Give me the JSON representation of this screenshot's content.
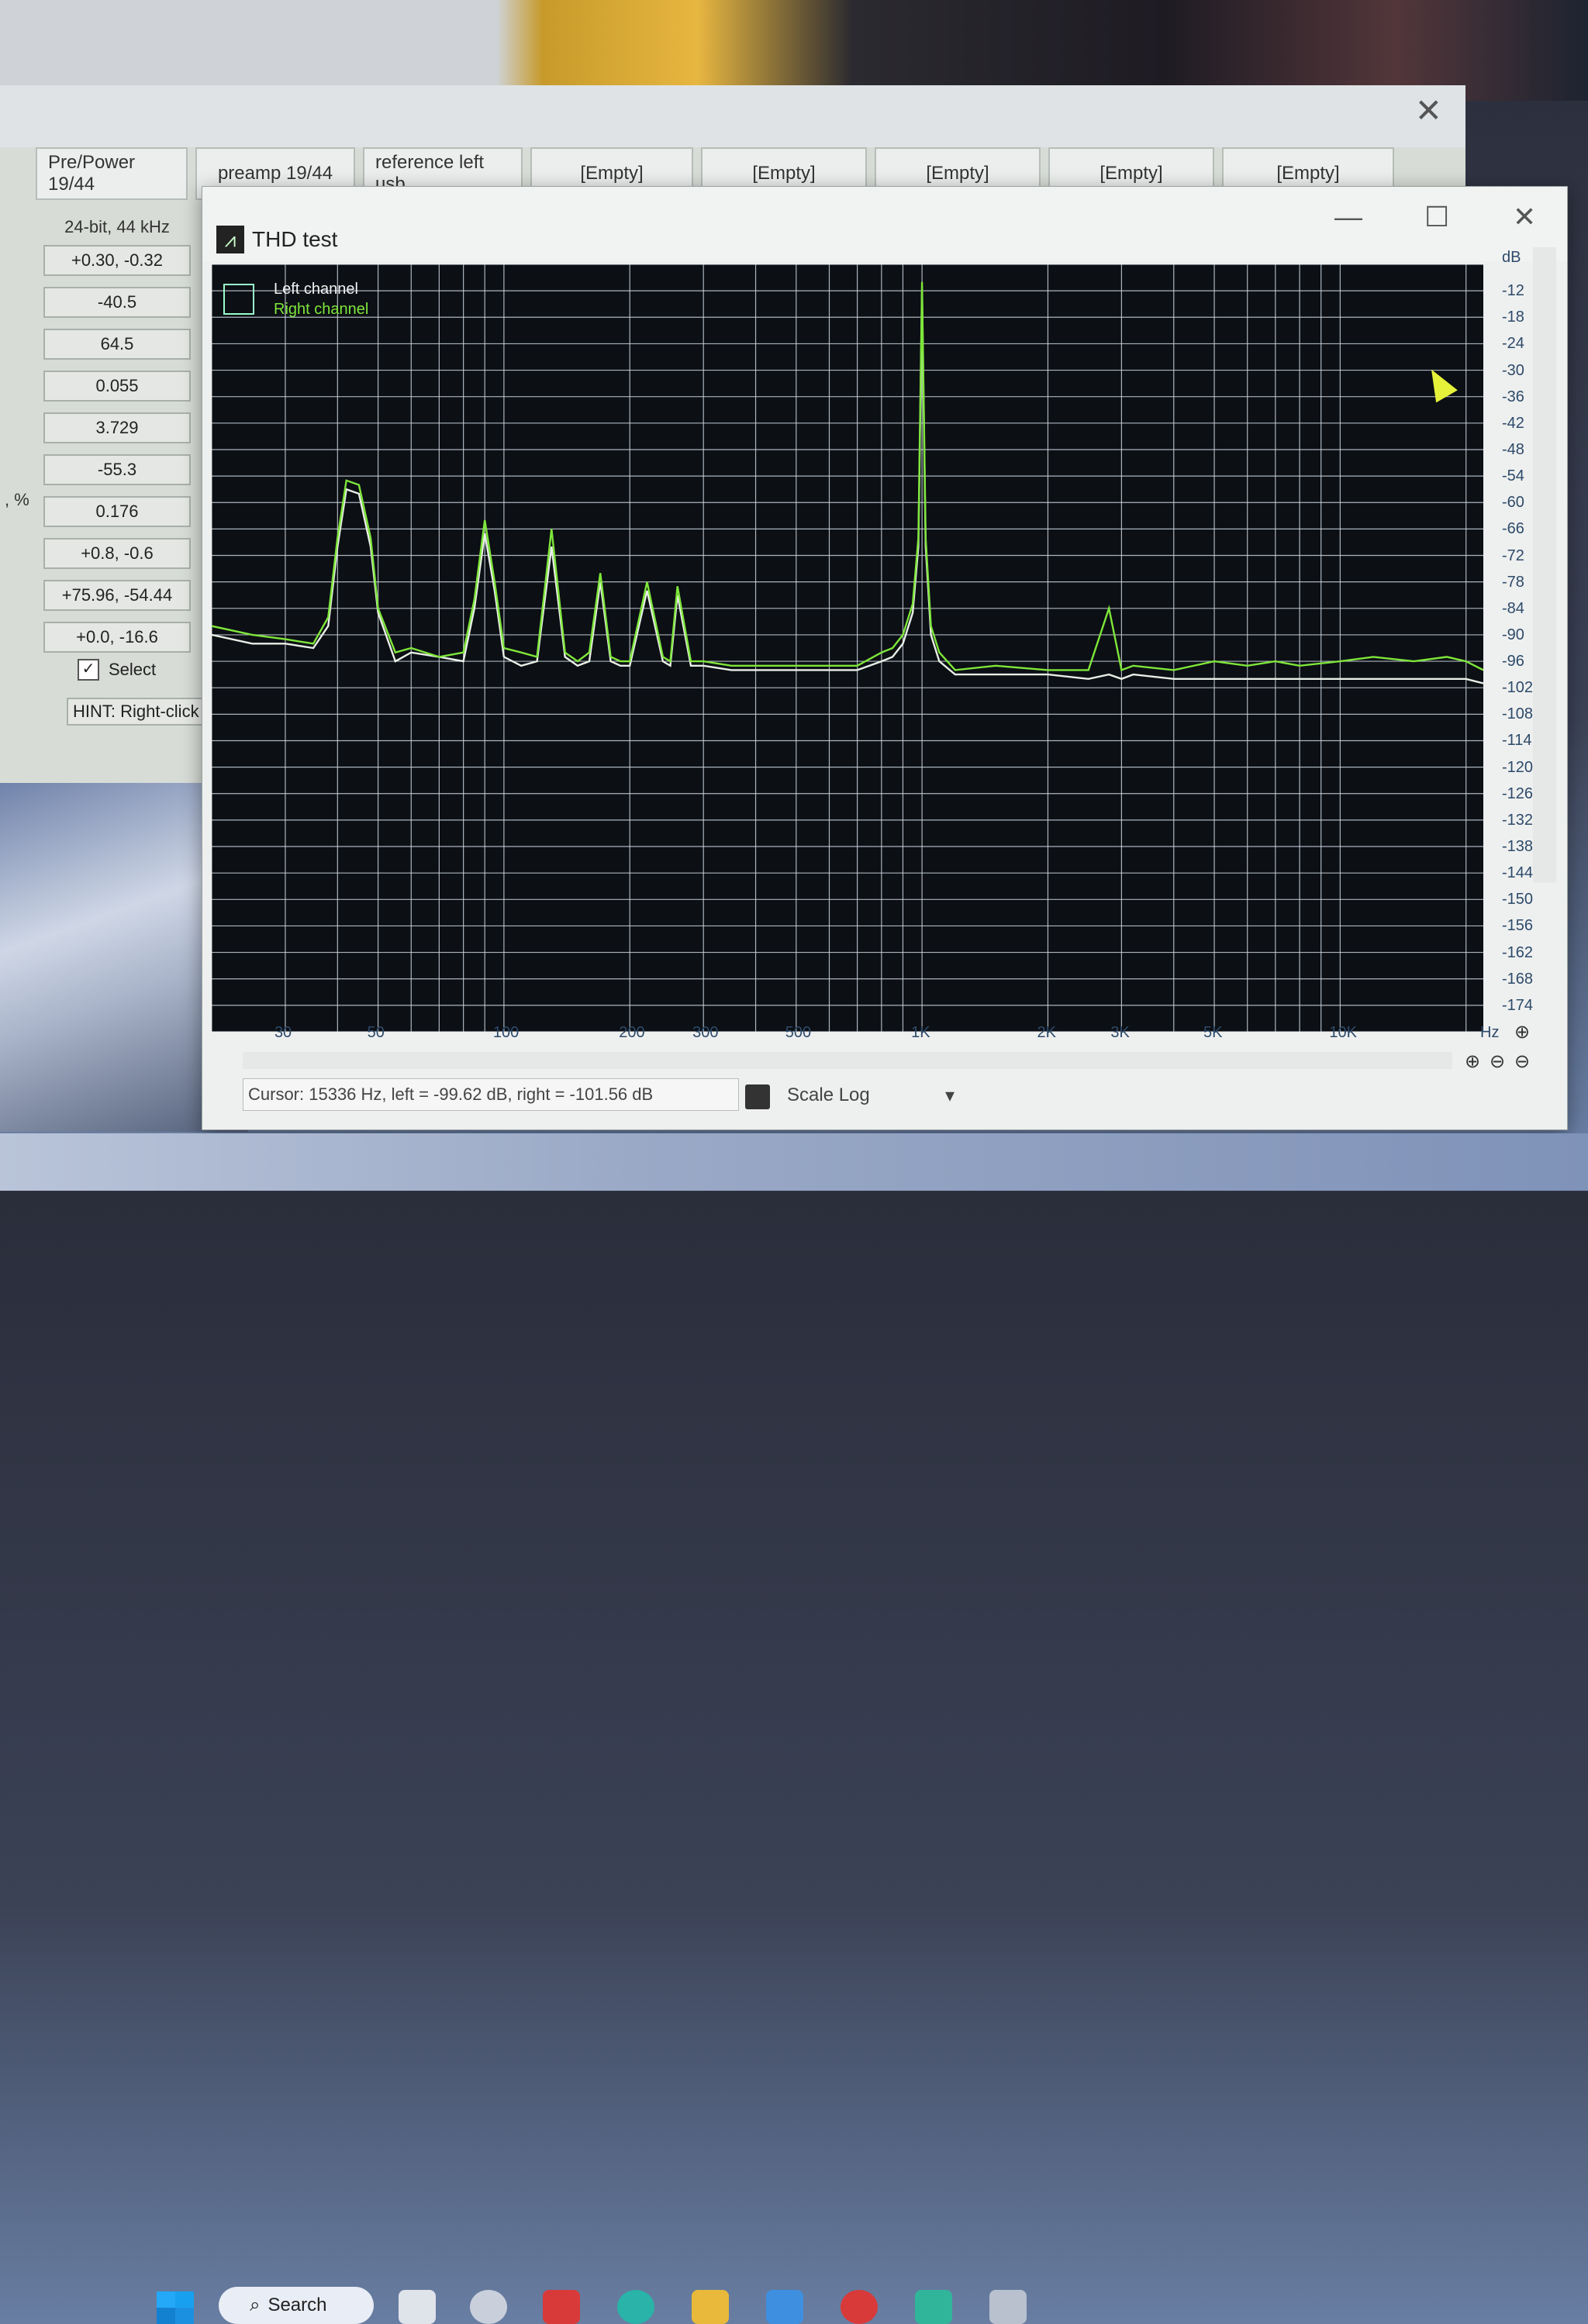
{
  "main_window": {
    "close_glyph": "✕",
    "tabs": [
      "Pre/Power 19/44",
      "preamp 19/44",
      "reference left usb",
      "[Empty]",
      "[Empty]",
      "[Empty]",
      "[Empty]",
      "[Empty]"
    ],
    "format_label": "24-bit, 44 kHz",
    "stats": [
      "+0.30, -0.32",
      "-40.5",
      "64.5",
      "0.055",
      "3.729",
      "-55.3",
      "0.176",
      "+0.8, -0.6",
      "+75.96, -54.44",
      "+0.0, -16.6"
    ],
    "pct_label": ", %",
    "select_checked": "✓",
    "select_label": "Select",
    "hint": "HINT: Right-click o"
  },
  "thd_window": {
    "icon_glyph": "⩘",
    "title": "THD test",
    "minimize_glyph": "—",
    "maximize_glyph": "☐",
    "close_glyph": "✕",
    "legend": {
      "left": "Left channel",
      "right": "Right channel"
    },
    "y_unit": "dB",
    "x_unit": "Hz",
    "cursor_text": "Cursor:  15336 Hz,  left = -99.62 dB,  right = -101.56 dB",
    "scale_label": "Scale Log",
    "zoom_in_glyph": "⊕",
    "zoom_out_glyph": "⊖"
  },
  "taskbar": {
    "search_label": "Search"
  },
  "colors": {
    "left_channel": "#e8efe6",
    "right_channel": "#7ee63a",
    "grid": "#c9d2dc",
    "plot_bg": "#0c0f14"
  },
  "chart_data": {
    "type": "line",
    "x_scale": "log",
    "xlim": [
      20,
      22000
    ],
    "ylim": [
      -180,
      -6
    ],
    "x_ticks": [
      30,
      50,
      100,
      200,
      300,
      500,
      1000,
      2000,
      3000,
      5000,
      10000
    ],
    "x_tick_labels": [
      "30",
      "50",
      "100",
      "200",
      "300",
      "500",
      "1K",
      "2K",
      "3K",
      "5K",
      "10K"
    ],
    "y_ticks": [
      -12,
      -18,
      -24,
      -30,
      -36,
      -42,
      -48,
      -54,
      -60,
      -66,
      -72,
      -78,
      -84,
      -90,
      -96,
      -102,
      -108,
      -114,
      -120,
      -126,
      -132,
      -138,
      -144,
      -150,
      -156,
      -162,
      -168,
      -174
    ],
    "series": [
      {
        "name": "Left channel",
        "x": [
          20,
          25,
          30,
          35,
          38,
          40,
          42,
          45,
          48,
          50,
          55,
          60,
          70,
          80,
          85,
          90,
          95,
          100,
          110,
          120,
          130,
          140,
          150,
          160,
          170,
          180,
          190,
          200,
          220,
          240,
          250,
          260,
          280,
          300,
          350,
          400,
          450,
          500,
          600,
          700,
          800,
          850,
          900,
          950,
          980,
          1000,
          1020,
          1050,
          1100,
          1200,
          1500,
          2000,
          2500,
          2800,
          3000,
          3200,
          4000,
          5000,
          6000,
          7000,
          8000,
          10000,
          12000,
          15000,
          18000,
          20000,
          22000
        ],
        "y": [
          -90,
          -92,
          -92,
          -93,
          -88,
          -70,
          -57,
          -58,
          -70,
          -85,
          -96,
          -94,
          -95,
          -96,
          -84,
          -67,
          -80,
          -95,
          -97,
          -96,
          -70,
          -95,
          -97,
          -96,
          -78,
          -96,
          -97,
          -97,
          -80,
          -96,
          -97,
          -81,
          -97,
          -97,
          -98,
          -98,
          -98,
          -98,
          -98,
          -98,
          -96,
          -95,
          -92,
          -85,
          -70,
          -12,
          -70,
          -90,
          -96,
          -99,
          -99,
          -99,
          -100,
          -99,
          -100,
          -99,
          -100,
          -100,
          -100,
          -100,
          -100,
          -100,
          -100,
          -100,
          -100,
          -100,
          -101
        ]
      },
      {
        "name": "Right channel",
        "x": [
          20,
          25,
          30,
          35,
          38,
          40,
          42,
          45,
          48,
          50,
          55,
          60,
          70,
          80,
          85,
          90,
          95,
          100,
          110,
          120,
          130,
          140,
          150,
          160,
          170,
          180,
          190,
          200,
          220,
          240,
          250,
          260,
          280,
          300,
          350,
          400,
          450,
          500,
          600,
          700,
          800,
          850,
          900,
          950,
          980,
          1000,
          1020,
          1050,
          1100,
          1200,
          1500,
          2000,
          2500,
          2800,
          3000,
          3200,
          4000,
          5000,
          6000,
          7000,
          8000,
          10000,
          12000,
          15000,
          18000,
          20000,
          22000
        ],
        "y": [
          -88,
          -90,
          -91,
          -92,
          -86,
          -68,
          -55,
          -56,
          -68,
          -84,
          -94,
          -93,
          -95,
          -94,
          -82,
          -64,
          -78,
          -93,
          -94,
          -95,
          -66,
          -94,
          -96,
          -94,
          -76,
          -95,
          -96,
          -96,
          -78,
          -95,
          -96,
          -79,
          -96,
          -96,
          -97,
          -97,
          -97,
          -97,
          -97,
          -97,
          -94,
          -93,
          -90,
          -83,
          -68,
          -10,
          -68,
          -88,
          -94,
          -98,
          -97,
          -98,
          -98,
          -84,
          -98,
          -97,
          -98,
          -96,
          -97,
          -96,
          -97,
          -96,
          -95,
          -96,
          -95,
          -96,
          -98
        ]
      }
    ]
  }
}
